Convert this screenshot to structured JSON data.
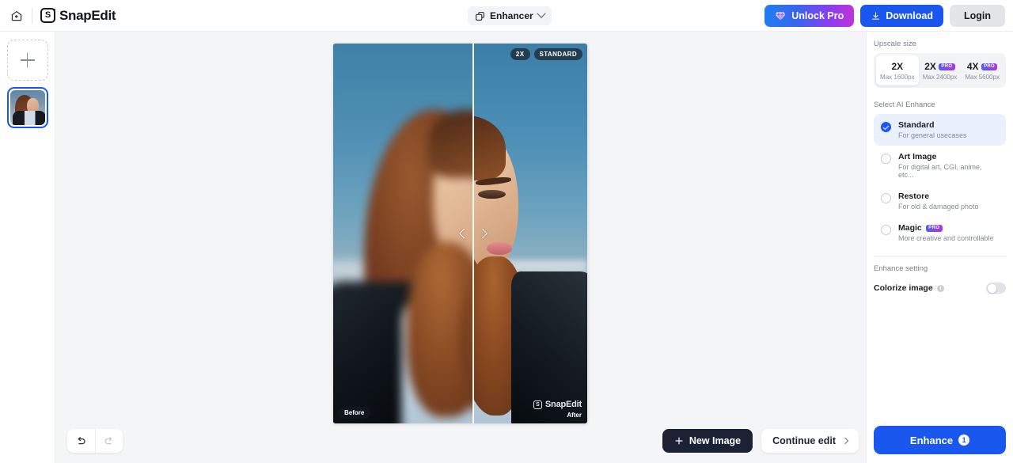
{
  "header": {
    "home_icon": "home-back-icon",
    "brand": {
      "mark": "S",
      "name": "SnapEdit"
    },
    "tool_selector": {
      "label": "Enhancer",
      "icon": "enhancer-icon",
      "chevron": "chevron-down-icon"
    },
    "unlock_pro": {
      "label": "Unlock Pro",
      "icon": "gem-icon"
    },
    "download": {
      "label": "Download",
      "icon": "download-icon"
    },
    "login": {
      "label": "Login"
    }
  },
  "rail": {
    "add_label": "+",
    "add_icon": "plus-icon",
    "thumbnail_alt": "woman-profile-thumbnail"
  },
  "canvas": {
    "badges": {
      "scale": "2X",
      "mode": "STANDARD"
    },
    "before_label": "Before",
    "after_label": "After",
    "watermark": {
      "mark": "S",
      "text": "SnapEdit"
    },
    "slider": {
      "left_icon": "chevron-left-icon",
      "right_icon": "chevron-right-icon",
      "position_percent": 55
    },
    "undo": {
      "icon": "undo-icon",
      "enabled": true
    },
    "redo": {
      "icon": "redo-icon",
      "enabled": false
    },
    "new_image": {
      "label": "New Image",
      "icon": "plus-icon"
    },
    "continue_edit": {
      "label": "Continue edit",
      "icon": "chevron-right-icon"
    }
  },
  "panel": {
    "upscale": {
      "section_label": "Upscale size",
      "options": [
        {
          "factor": "2X",
          "max": "Max 1600px",
          "pro": false,
          "selected": true
        },
        {
          "factor": "2X",
          "max": "Max 2400px",
          "pro": true,
          "selected": false
        },
        {
          "factor": "4X",
          "max": "Max 5600px",
          "pro": true,
          "selected": false
        }
      ],
      "pro_badge": "PRO"
    },
    "enhance": {
      "section_label": "Select AI Enhance",
      "options": [
        {
          "title": "Standard",
          "desc": "For general usecases",
          "pro": false,
          "selected": true
        },
        {
          "title": "Art Image",
          "desc": "For digital art, CGI, anime, etc...",
          "pro": false,
          "selected": false
        },
        {
          "title": "Restore",
          "desc": "For old & damaged photo",
          "pro": false,
          "selected": false
        },
        {
          "title": "Magic",
          "desc": "More creative and controllable",
          "pro": true,
          "selected": false
        }
      ],
      "pro_badge": "PRO"
    },
    "setting": {
      "section_label": "Enhance setting",
      "colorize_label": "Colorize image",
      "info_icon": "info-icon",
      "colorize_on": false
    },
    "enhance_button": {
      "label": "Enhance",
      "credits": "1"
    }
  },
  "colors": {
    "accent_blue": "#1a57ef",
    "dark_navy": "#1c2233",
    "selected_row": "#eaf0fe",
    "panel_bg": "#ffffff",
    "app_bg": "#f4f5f7",
    "pro_gradient_start": "#4b5ff0",
    "pro_gradient_end": "#b235e0"
  }
}
